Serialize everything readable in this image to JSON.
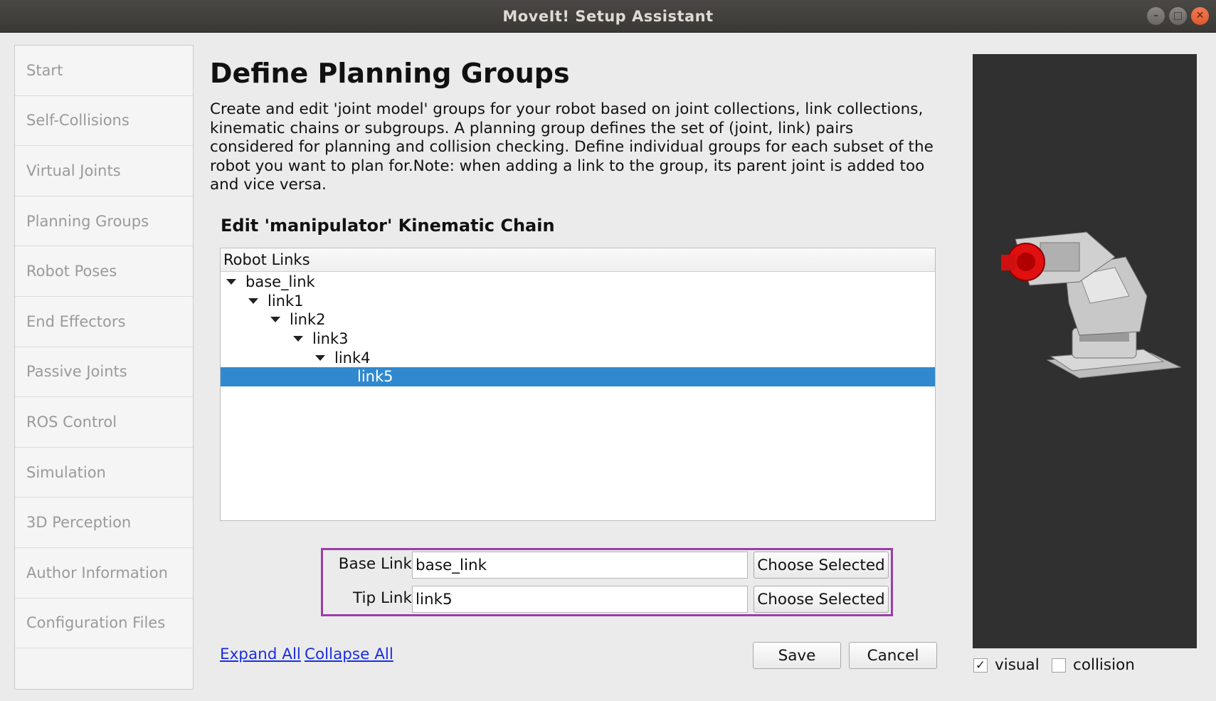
{
  "window": {
    "title": "MoveIt! Setup Assistant"
  },
  "sidebar": {
    "items": [
      {
        "label": "Start"
      },
      {
        "label": "Self-Collisions"
      },
      {
        "label": "Virtual Joints"
      },
      {
        "label": "Planning Groups"
      },
      {
        "label": "Robot Poses"
      },
      {
        "label": "End Effectors"
      },
      {
        "label": "Passive Joints"
      },
      {
        "label": "ROS Control"
      },
      {
        "label": "Simulation"
      },
      {
        "label": "3D Perception"
      },
      {
        "label": "Author Information"
      },
      {
        "label": "Configuration Files"
      }
    ]
  },
  "main": {
    "title": "Define Planning Groups",
    "description": "Create and edit 'joint model' groups for your robot based on joint collections, link collections, kinematic chains or subgroups. A planning group defines the set of (joint, link) pairs considered for planning and collision checking. Define individual groups for each subset of the robot you want to plan for.Note: when adding a link to the group, its parent joint is added too and vice versa.",
    "section_title": "Edit 'manipulator' Kinematic Chain",
    "tree": {
      "header": "Robot Links",
      "nodes": [
        {
          "label": "base_link",
          "depth": 0,
          "expanded": true
        },
        {
          "label": "link1",
          "depth": 1,
          "expanded": true
        },
        {
          "label": "link2",
          "depth": 2,
          "expanded": true
        },
        {
          "label": "link3",
          "depth": 3,
          "expanded": true
        },
        {
          "label": "link4",
          "depth": 4,
          "expanded": true
        },
        {
          "label": "link5",
          "depth": 5,
          "selected": true
        }
      ]
    },
    "base_link": {
      "label": "Base Link",
      "value": "base_link",
      "button": "Choose Selected"
    },
    "tip_link": {
      "label": "Tip Link",
      "value": "link5",
      "button": "Choose Selected"
    },
    "expand_all": "Expand All",
    "collapse_all": "Collapse All",
    "save": "Save",
    "cancel": "Cancel"
  },
  "viewer": {
    "visual_label": "visual",
    "visual_checked": true,
    "collision_label": "collision",
    "collision_checked": false
  },
  "colors": {
    "selection": "#3089ce",
    "highlight_box": "#9b3ea8",
    "end_effector": "#e01010"
  }
}
